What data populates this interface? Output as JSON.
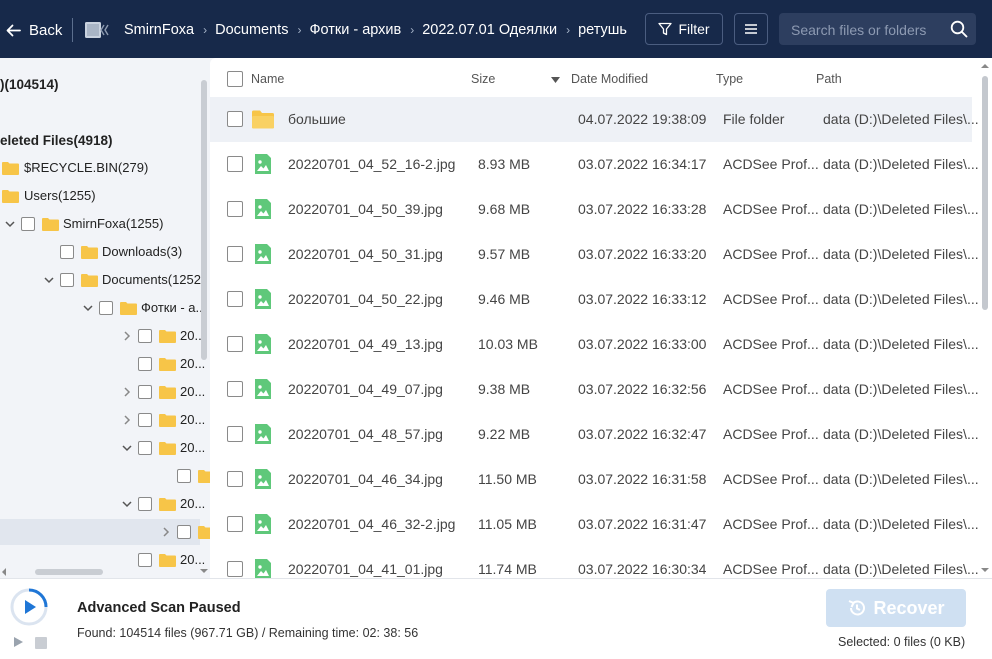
{
  "header": {
    "back_label": "Back",
    "breadcrumbs": [
      "SmirnFoxa",
      "Documents",
      "Фотки - архив",
      "2022.07.01 Одеялки",
      "ретушь"
    ],
    "filter_label": "Filter",
    "search_placeholder": "Search files or folders"
  },
  "tree": {
    "root_label": ")(104514)",
    "deleted_label": "eleted Files(4918)",
    "items": [
      {
        "label": "$RECYCLE.BIN(279)"
      },
      {
        "label": "Users(1255)"
      },
      {
        "label": "SmirnFoxa(1255)"
      },
      {
        "label": "Downloads(3)"
      },
      {
        "label": "Documents(1252"
      },
      {
        "label": "Фотки - а..."
      },
      {
        "label": "20..."
      },
      {
        "label": "20..."
      },
      {
        "label": "20..."
      },
      {
        "label": "20..."
      },
      {
        "label": "20..."
      },
      {
        "label": "20..."
      },
      {
        "label": "20..."
      }
    ]
  },
  "table": {
    "columns": {
      "name": "Name",
      "size": "Size",
      "date": "Date Modified",
      "type": "Type",
      "path": "Path"
    },
    "rows": [
      {
        "name": "большие",
        "size": "",
        "date": "04.07.2022 19:38:09",
        "type": "File folder",
        "path": "data (D:)\\Deleted Files\\..."
      },
      {
        "name": "20220701_04_52_16-2.jpg",
        "size": "8.93 MB",
        "date": "03.07.2022 16:34:17",
        "type": "ACDSee Prof...",
        "path": "data (D:)\\Deleted Files\\..."
      },
      {
        "name": "20220701_04_50_39.jpg",
        "size": "9.68 MB",
        "date": "03.07.2022 16:33:28",
        "type": "ACDSee Prof...",
        "path": "data (D:)\\Deleted Files\\..."
      },
      {
        "name": "20220701_04_50_31.jpg",
        "size": "9.57 MB",
        "date": "03.07.2022 16:33:20",
        "type": "ACDSee Prof...",
        "path": "data (D:)\\Deleted Files\\..."
      },
      {
        "name": "20220701_04_50_22.jpg",
        "size": "9.46 MB",
        "date": "03.07.2022 16:33:12",
        "type": "ACDSee Prof...",
        "path": "data (D:)\\Deleted Files\\..."
      },
      {
        "name": "20220701_04_49_13.jpg",
        "size": "10.03 MB",
        "date": "03.07.2022 16:33:00",
        "type": "ACDSee Prof...",
        "path": "data (D:)\\Deleted Files\\..."
      },
      {
        "name": "20220701_04_49_07.jpg",
        "size": "9.38 MB",
        "date": "03.07.2022 16:32:56",
        "type": "ACDSee Prof...",
        "path": "data (D:)\\Deleted Files\\..."
      },
      {
        "name": "20220701_04_48_57.jpg",
        "size": "9.22 MB",
        "date": "03.07.2022 16:32:47",
        "type": "ACDSee Prof...",
        "path": "data (D:)\\Deleted Files\\..."
      },
      {
        "name": "20220701_04_46_34.jpg",
        "size": "11.50 MB",
        "date": "03.07.2022 16:31:58",
        "type": "ACDSee Prof...",
        "path": "data (D:)\\Deleted Files\\..."
      },
      {
        "name": "20220701_04_46_32-2.jpg",
        "size": "11.05 MB",
        "date": "03.07.2022 16:31:47",
        "type": "ACDSee Prof...",
        "path": "data (D:)\\Deleted Files\\..."
      },
      {
        "name": "20220701_04_41_01.jpg",
        "size": "11.74 MB",
        "date": "03.07.2022 16:30:34",
        "type": "ACDSee Prof...",
        "path": "data (D:)\\Deleted Files\\..."
      }
    ]
  },
  "footer": {
    "status_title": "Advanced Scan Paused",
    "status_detail": "Found: 104514 files (967.71 GB) / Remaining time: 02: 38: 56",
    "recover_label": "Recover",
    "selected_info": "Selected: 0 files (0 KB)"
  },
  "colors": {
    "header_bg": "#17294a",
    "folder": "#f7c548",
    "image_icon": "#5fc87a",
    "accent": "#1f76d6",
    "recover_disabled": "#cfe0f2"
  }
}
